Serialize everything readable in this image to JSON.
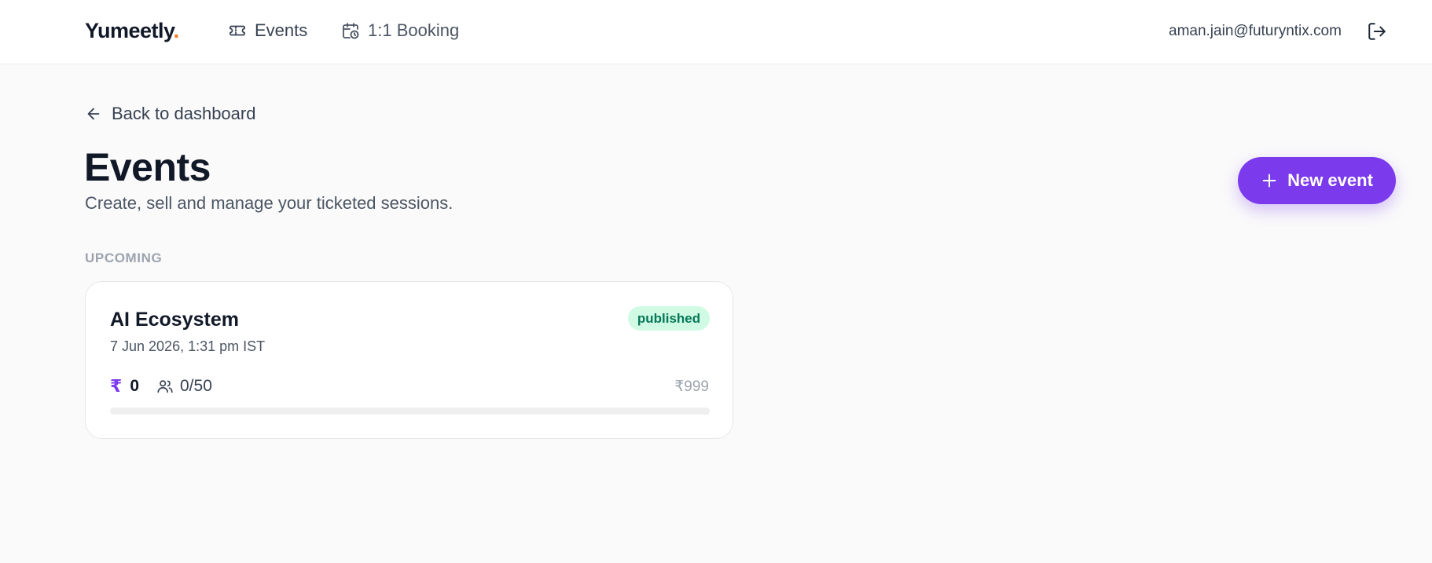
{
  "header": {
    "brand": "Yumeetly",
    "brand_dot": ".",
    "nav": [
      {
        "label": "Events",
        "icon": "ticket-icon"
      },
      {
        "label": "1:1 Booking",
        "icon": "calendar-clock-icon"
      }
    ],
    "user_email": "aman.jain@futuryntix.com",
    "logout_icon": "logout-icon"
  },
  "main": {
    "back_label": "Back to dashboard",
    "title": "Events",
    "subtitle": "Create, sell and manage your ticketed sessions.",
    "new_event_label": "New event",
    "section_label": "UPCOMING",
    "events": [
      {
        "name": "AI Ecosystem",
        "date": "7 Jun 2026, 1:31 pm IST",
        "status": "published",
        "currency_symbol": "₹",
        "revenue": "0",
        "attendees": "0/50",
        "price": "₹999",
        "progress": 0
      }
    ]
  },
  "colors": {
    "accent": "#7c3aed",
    "brand_dot": "#f97316",
    "status_bg": "#d1fae5",
    "status_text": "#047857"
  }
}
